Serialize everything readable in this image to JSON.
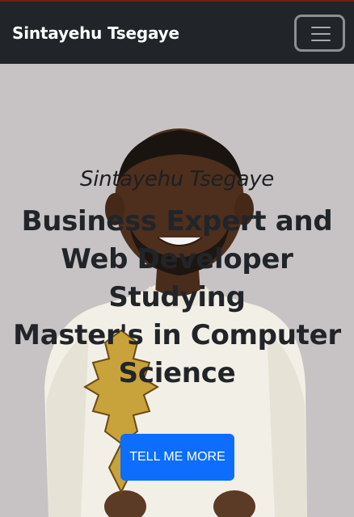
{
  "navbar": {
    "brand": "Sintayehu Tsegaye",
    "toggler_icon": "hamburger-menu-icon"
  },
  "hero": {
    "subtitle": "Sintayehu Tsegaye",
    "title_lines": [
      "Business Expert and",
      "Web Developer",
      "Studying",
      "Master's in Computer",
      "Science"
    ],
    "button_label": "TELL ME MORE",
    "background_image": "portrait photo of a smiling man in a white embroidered shirt"
  },
  "colors": {
    "navbar_bg": "#212529",
    "hero_bg": "#c7c3c4",
    "button_bg": "#0d6efd",
    "text_dark": "#212529"
  }
}
